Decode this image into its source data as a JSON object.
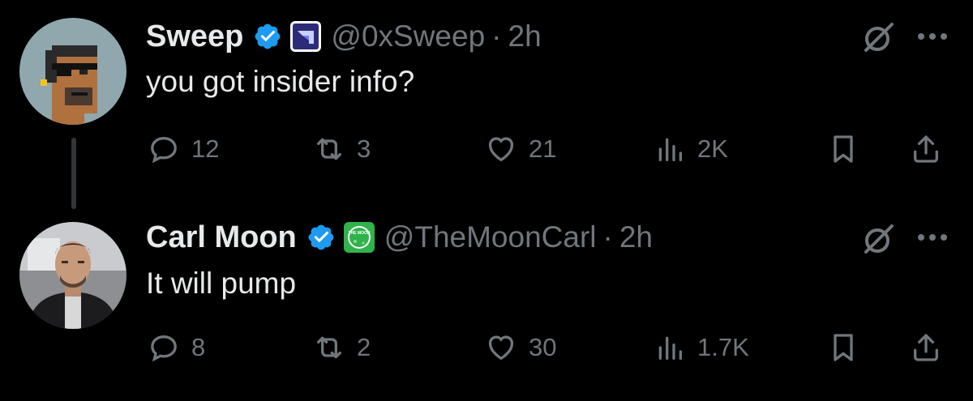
{
  "tweets": [
    {
      "author_name": "Sweep",
      "handle": "@0xSweep",
      "separator": "·",
      "time": "2h",
      "text": "you got insider info?",
      "affiliate_icon": "sweep-logo-icon",
      "stats": {
        "replies": "12",
        "reposts": "3",
        "likes": "21",
        "views": "2K"
      }
    },
    {
      "author_name": "Carl Moon",
      "handle": "@TheMoonCarl",
      "separator": "·",
      "time": "2h",
      "text": "It will pump",
      "affiliate_icon": "the-moon-logo-icon",
      "affiliate_text": "THE MOON",
      "stats": {
        "replies": "8",
        "reposts": "2",
        "likes": "30",
        "views": "1.7K"
      }
    }
  ],
  "colors": {
    "background": "#000000",
    "primary_text": "#e7e9ea",
    "secondary_text": "#71767b",
    "verified_blue": "#1d9bf0",
    "thread_line": "#333639"
  }
}
